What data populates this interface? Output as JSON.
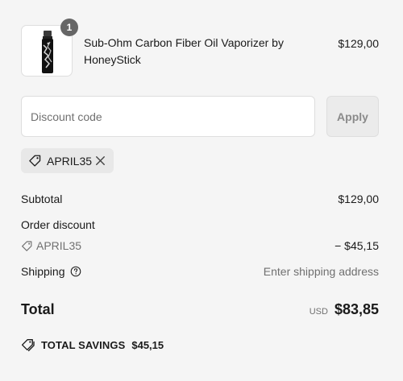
{
  "product": {
    "quantity": "1",
    "name": "Sub-Ohm Carbon Fiber Oil Vaporizer by HoneyStick",
    "price": "$129,00",
    "image": "vaporizer-product-image"
  },
  "discount_form": {
    "placeholder": "Discount code",
    "value": "",
    "apply_label": "Apply"
  },
  "applied_code": {
    "code": "APRIL35",
    "tag_icon": "tag-icon",
    "remove_icon": "close-icon"
  },
  "summary": {
    "subtotal_label": "Subtotal",
    "subtotal_value": "$129,00",
    "order_discount_label": "Order discount",
    "discount_code": "APRIL35",
    "discount_value": "− $45,15",
    "shipping_label": "Shipping",
    "shipping_value": "Enter shipping address",
    "total_label": "Total",
    "currency": "USD",
    "total_value": "$83,85"
  },
  "savings": {
    "label": "TOTAL SAVINGS",
    "value": "$45,15"
  },
  "colors": {
    "background": "#f5f5f5",
    "muted_text": "#707070",
    "border": "#dedede",
    "badge": "#666666"
  }
}
